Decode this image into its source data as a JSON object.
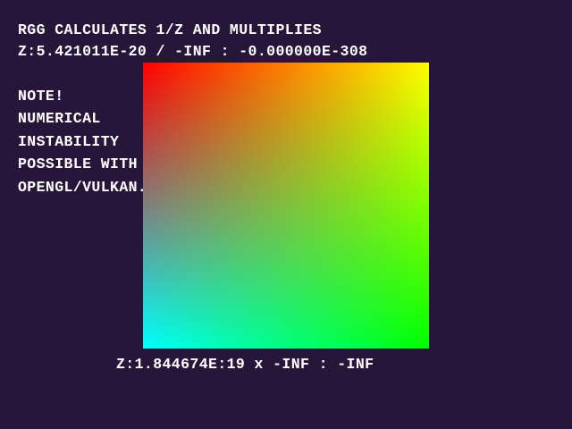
{
  "header": {
    "title": "RGG CALCULATES 1/Z AND MULTIPLIES",
    "equation": "Z:5.421011E-20 / -INF : -0.000000E-308"
  },
  "note": {
    "lines": [
      "NOTE!",
      "NUMERICAL",
      "INSTABILITY",
      "POSSIBLE WITH",
      "OPENGL/VULKAN."
    ]
  },
  "footer": {
    "equation": "Z:1.844674E:19 x -INF : -INF"
  },
  "gradient": {
    "corners": {
      "top_left": "#ff0000",
      "top_right": "#ffff00",
      "bottom_left": "#00ffff",
      "bottom_right": "#00ff00"
    }
  },
  "colors": {
    "background": "#28163a",
    "text": "#ffffff"
  }
}
